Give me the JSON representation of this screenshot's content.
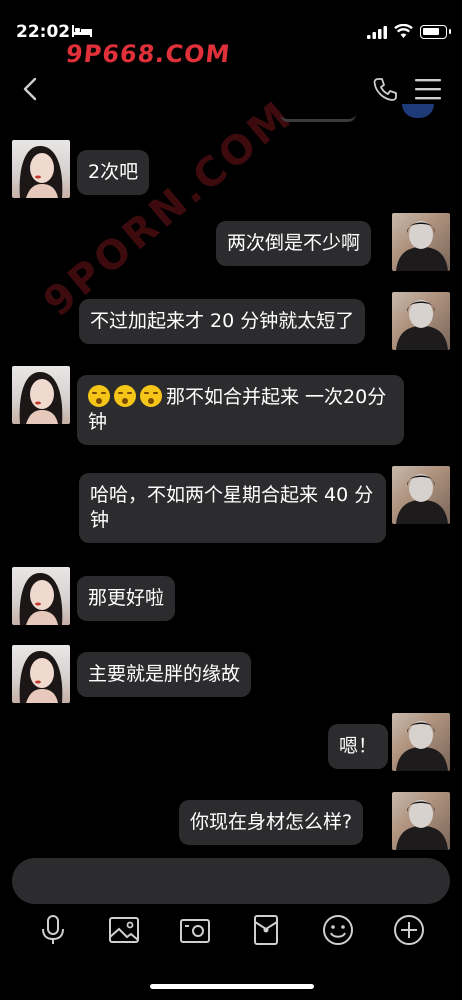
{
  "status_bar": {
    "time": "22:02"
  },
  "watermark": {
    "text": "9P668.COM",
    "diagonal": "9PORN.COM"
  },
  "header": {
    "back_icon": "chevron-left-icon",
    "call_icon": "phone-icon",
    "menu_icon": "hamburger-icon"
  },
  "messages": [
    {
      "sender": "other",
      "text": "2次吧"
    },
    {
      "sender": "me",
      "text": "两次倒是不少啊"
    },
    {
      "sender": "me",
      "text": "不过加起来才 20 分钟就太短了"
    },
    {
      "sender": "other",
      "emoji": "yawning-face",
      "emoji_count": 3,
      "text": "那不如合并起来 一次20分钟"
    },
    {
      "sender": "me",
      "text": "哈哈，不如两个星期合起来 40 分钟"
    },
    {
      "sender": "other",
      "text": "那更好啦"
    },
    {
      "sender": "other",
      "text": "主要就是胖的缘故"
    },
    {
      "sender": "me",
      "text": "嗯！"
    },
    {
      "sender": "me",
      "text": "你现在身材怎么样?"
    }
  ],
  "input": {
    "placeholder": ""
  },
  "toolbar": {
    "icons": [
      "microphone-icon",
      "image-icon",
      "camera-icon",
      "red-packet-icon",
      "emoji-icon",
      "plus-icon"
    ]
  },
  "colors": {
    "background": "#000000",
    "bubble": "#2c2c2e",
    "watermark": "#e0303a"
  }
}
